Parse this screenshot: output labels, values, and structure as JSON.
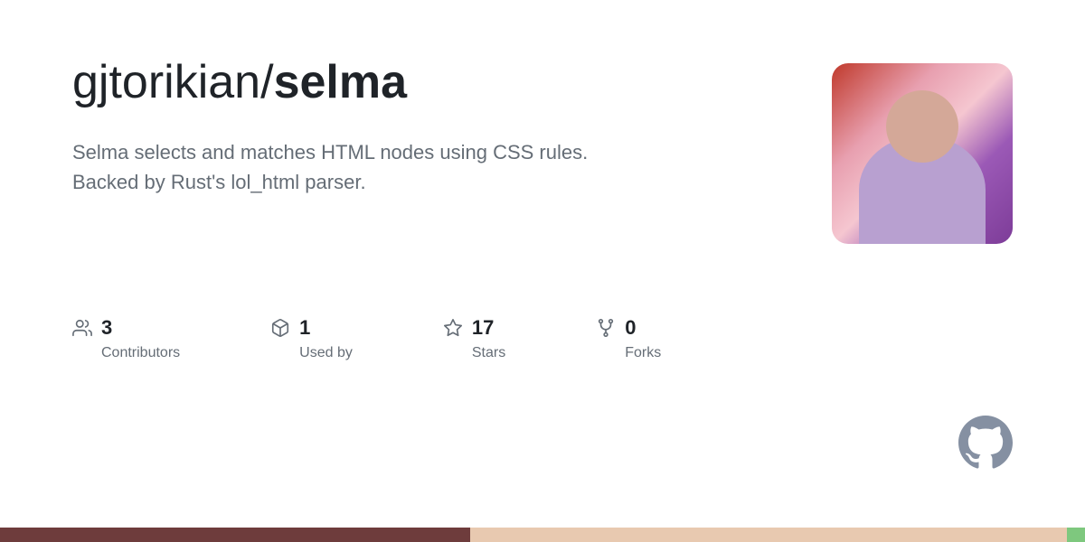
{
  "header": {
    "owner": "gjtorikian/",
    "repo_name": "selma"
  },
  "description": "Selma selects and matches HTML nodes using CSS rules. Backed by Rust's lol_html parser.",
  "stats": [
    {
      "id": "contributors",
      "number": "3",
      "label": "Contributors",
      "icon": "people-icon"
    },
    {
      "id": "used-by",
      "number": "1",
      "label": "Used by",
      "icon": "package-icon"
    },
    {
      "id": "stars",
      "number": "17",
      "label": "Stars",
      "icon": "star-icon"
    },
    {
      "id": "forks",
      "number": "0",
      "label": "Forks",
      "icon": "fork-icon"
    }
  ],
  "colors": {
    "title": "#1f2328",
    "description": "#656d76",
    "stat_number": "#1f2328",
    "stat_label": "#656d76",
    "bottom_bar_1": "#6e3c3c",
    "bottom_bar_2": "#e8c9b0",
    "bottom_bar_3": "#7ec87e"
  }
}
